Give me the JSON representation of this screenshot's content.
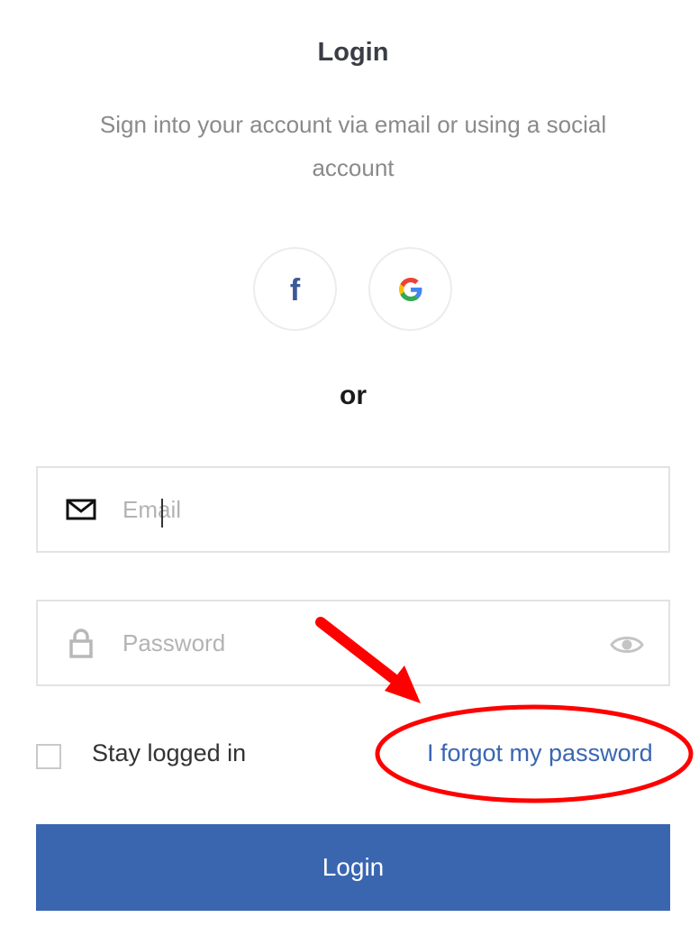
{
  "header": {
    "title": "Login",
    "subtitle": "Sign into your account via email or using a social account"
  },
  "social": {
    "facebook_glyph": "f",
    "facebook_icon": "facebook-icon",
    "google_icon": "google-icon",
    "facebook_color": "#3b5998"
  },
  "divider": {
    "label": "or"
  },
  "form": {
    "email": {
      "placeholder": "Email",
      "value": "",
      "icon": "envelope-icon"
    },
    "password": {
      "placeholder": "Password",
      "value": "",
      "icon": "lock-icon",
      "toggle_icon": "eye-icon"
    },
    "stay_logged_in": {
      "label": "Stay logged in",
      "checked": false
    },
    "forgot_password": "I forgot my password",
    "submit_label": "Login"
  },
  "colors": {
    "primary": "#3a66b0",
    "annotation": "#ff0000"
  }
}
